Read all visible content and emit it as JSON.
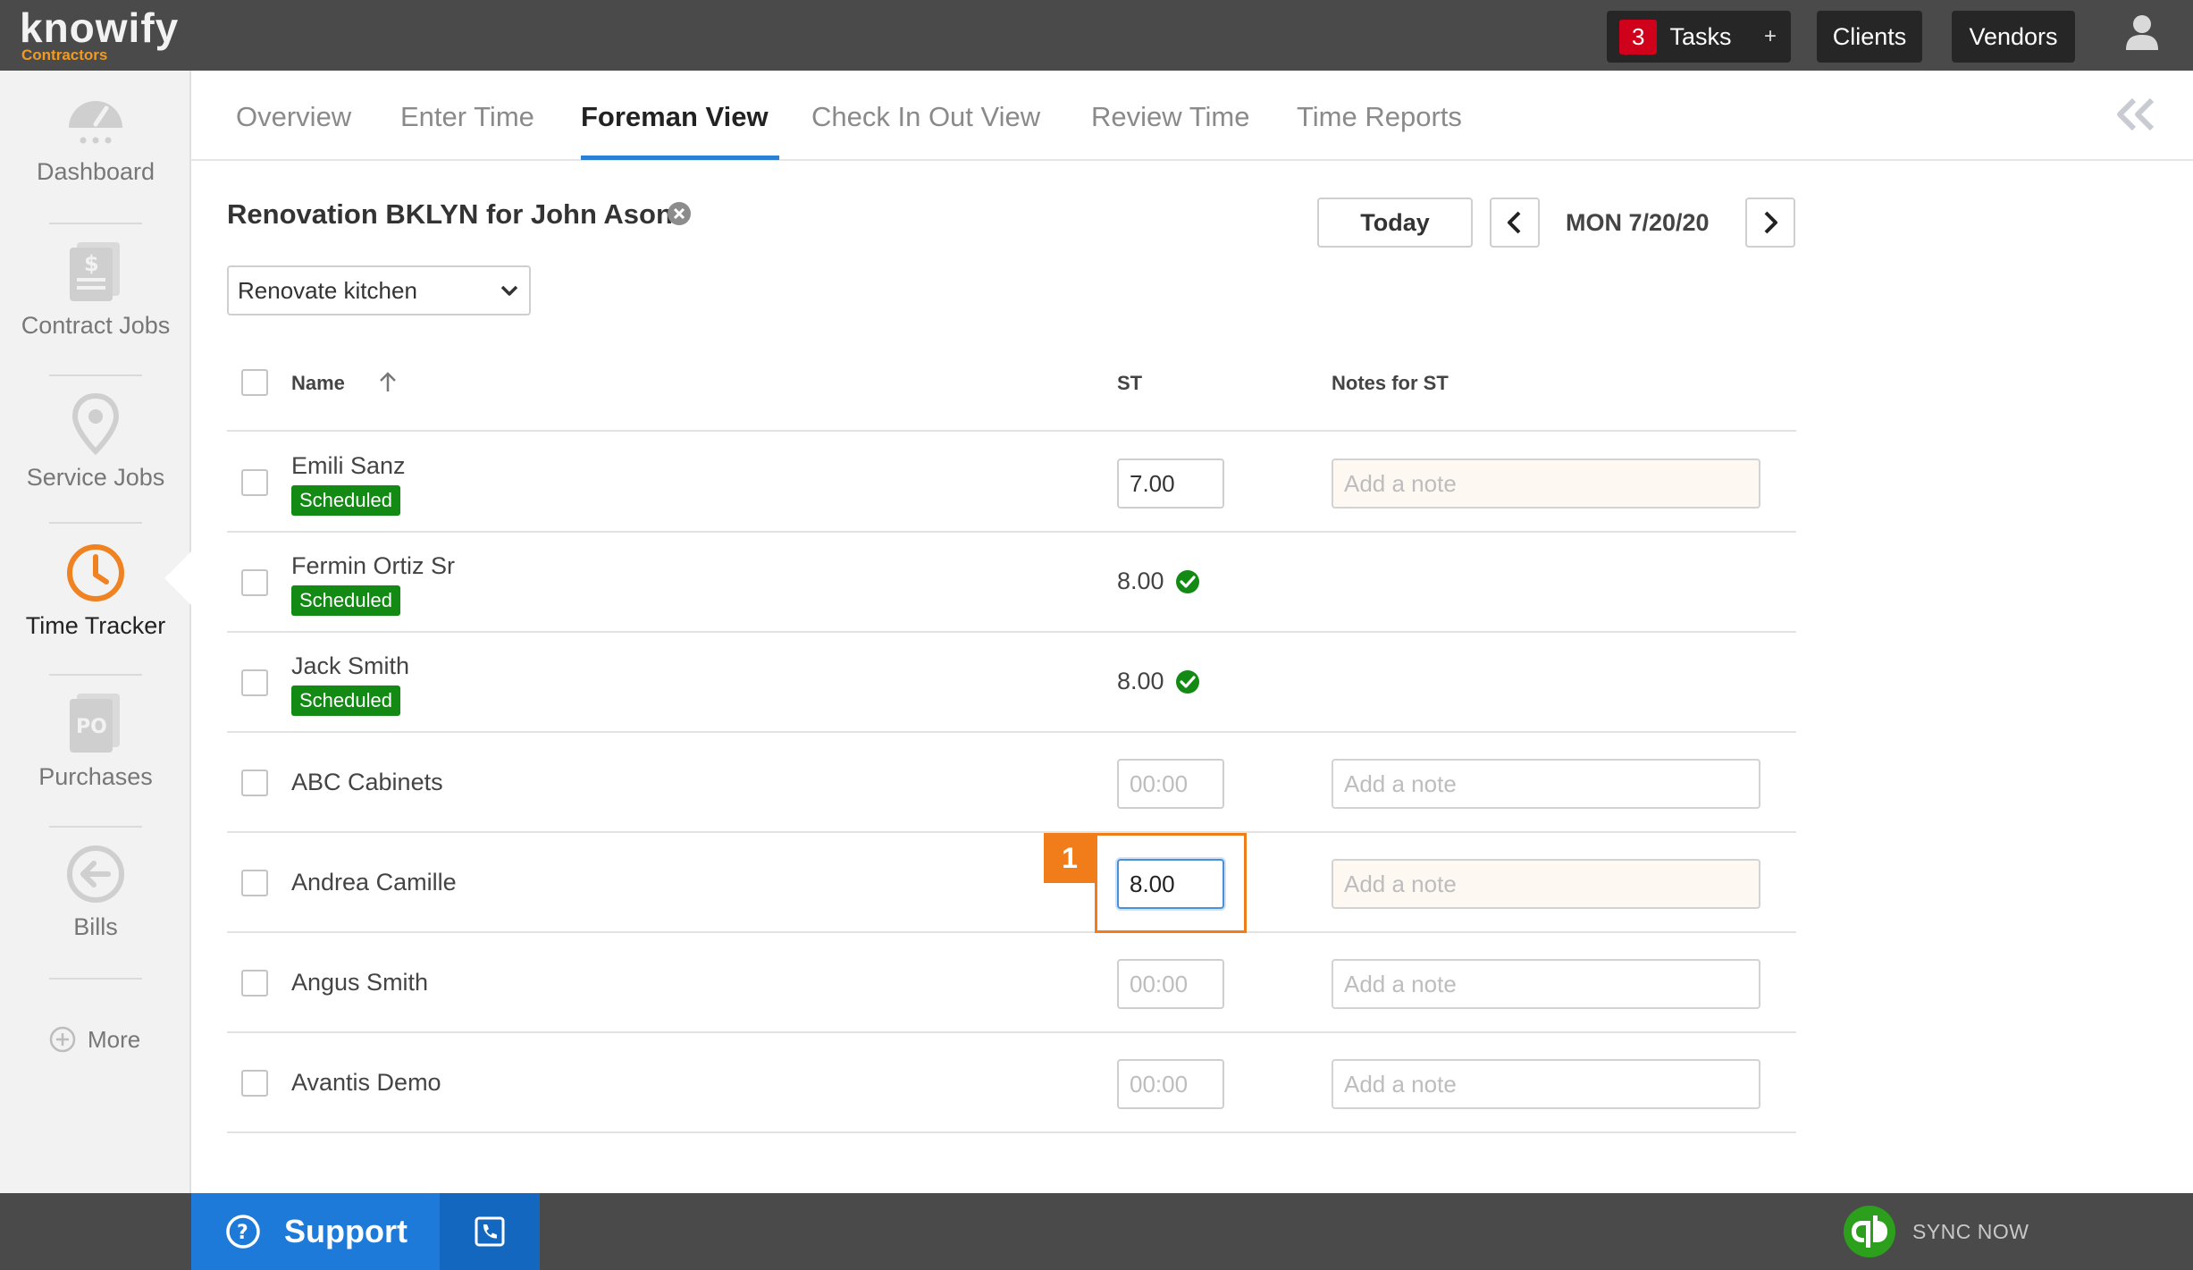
{
  "brand": {
    "name": "knowify",
    "sub": "Contractors",
    "accent": "#f29a1f"
  },
  "topbar": {
    "tasks_count": "3",
    "tasks_label": "Tasks",
    "tasks_plus": "+",
    "clients_label": "Clients",
    "vendors_label": "Vendors",
    "user_icon": "user-icon"
  },
  "sidebar": {
    "items": [
      {
        "label": "Dashboard",
        "icon": "gauge-icon"
      },
      {
        "label": "Contract Jobs",
        "icon": "document-dollar-icon"
      },
      {
        "label": "Service Jobs",
        "icon": "map-pin-icon"
      },
      {
        "label": "Time Tracker",
        "icon": "clock-icon",
        "active": true
      },
      {
        "label": "Purchases",
        "icon": "po-document-icon"
      },
      {
        "label": "Bills",
        "icon": "arrow-left-circle-icon"
      }
    ],
    "more_label": "More"
  },
  "tabs": [
    {
      "label": "Overview"
    },
    {
      "label": "Enter Time"
    },
    {
      "label": "Foreman View",
      "active": true
    },
    {
      "label": "Check In Out View"
    },
    {
      "label": "Review Time"
    },
    {
      "label": "Time Reports"
    }
  ],
  "job": {
    "title": "Renovation BKLYN for John Ason"
  },
  "date_nav": {
    "today_label": "Today",
    "date": "MON 7/20/20"
  },
  "task_select": {
    "value": "Renovate kitchen"
  },
  "table": {
    "headers": {
      "name": "Name",
      "st": "ST",
      "notes": "Notes for ST"
    },
    "rows": [
      {
        "name": "Emili Sanz",
        "badge": "Scheduled",
        "st": "7.00",
        "note_placeholder": "Add a note"
      },
      {
        "name": "Fermin Ortiz Sr",
        "badge": "Scheduled",
        "st": "8.00"
      },
      {
        "name": "Jack Smith",
        "badge": "Scheduled",
        "st": "8.00"
      },
      {
        "name": "ABC Cabinets",
        "st_placeholder": "00:00",
        "note_placeholder": "Add a note"
      },
      {
        "name": "Andrea Camille",
        "st": "8.00",
        "note_placeholder": "Add a note"
      },
      {
        "name": "Angus Smith",
        "st_placeholder": "00:00",
        "note_placeholder": "Add a note"
      },
      {
        "name": "Avantis Demo",
        "st_placeholder": "00:00",
        "note_placeholder": "Add a note"
      }
    ]
  },
  "annotation": {
    "number": "1"
  },
  "footer": {
    "support_label": "Support",
    "sync_label": "SYNC NOW"
  },
  "colors": {
    "tab_active": "#2d7fd3",
    "scheduled_badge": "#128a14",
    "annotation": "#f07d1a",
    "support": "#1d7ad9"
  }
}
